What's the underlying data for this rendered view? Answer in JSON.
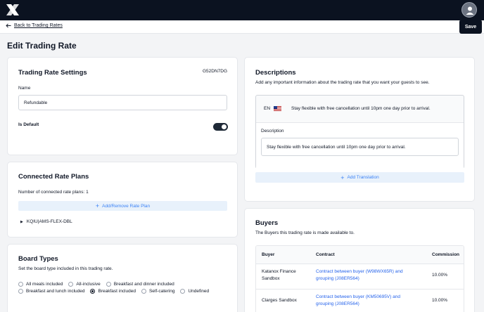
{
  "header": {
    "logo_icon": "x-logo-icon",
    "avatar_icon": "user-icon"
  },
  "nav": {
    "back_label": "Back to Trading Rates",
    "save_label": "Save"
  },
  "page": {
    "title": "Edit Trading Rate"
  },
  "settings": {
    "title": "Trading Rate Settings",
    "code": "G52DN7DG",
    "name_label": "Name",
    "name_value": "Refundable",
    "default_label": "Is Default",
    "default_on": true
  },
  "rate_plans": {
    "title": "Connected Rate Plans",
    "count_text": "Number of connected rate plans: 1",
    "button_label": "Add/Remove Rate Plan",
    "items": [
      "KQIU|AMS-FLEX-DBL"
    ]
  },
  "board_types": {
    "title": "Board Types",
    "subtitle": "Set the board type included in this trading rate.",
    "row1": [
      "All meals included",
      "All-inclusive",
      "Breakfast and dinner included"
    ],
    "row2": [
      "Breakfast and lunch included",
      "Breakfast included",
      "Self-catering",
      "Undefined"
    ],
    "selected": "Breakfast included"
  },
  "descriptions": {
    "title": "Descriptions",
    "subtitle": "Add any important information about the trading rate that you want your guests to see.",
    "lang": "EN",
    "preview": "Stay flexible with free cancellation until 10pm one day prior to arrival.",
    "field_label": "Description",
    "field_value": "Stay flexible with free cancellation until 10pm one day prior to arrival.",
    "add_translation": "Add Translation"
  },
  "buyers": {
    "title": "Buyers",
    "subtitle": "The Buyers this trading rate is made available to.",
    "columns": [
      "Buyer",
      "Contract",
      "Commission"
    ],
    "rows": [
      {
        "buyer_1": "Katanox Finance",
        "buyer_2": "Sandbox",
        "contract_1": "Contract between buyer (W98WX65R) and",
        "contract_2": "grouping (J08ER564)",
        "commission": "10.00%"
      },
      {
        "buyer_1": "Clarges Sandbox",
        "buyer_2": "",
        "contract_1": "Contract between buyer (KM50695V) and",
        "contract_2": "grouping (J08ER564)",
        "commission": "10.00%"
      }
    ]
  },
  "colors": {
    "dark": "#0b1220",
    "accent_blue": "#3b82f6",
    "blue_bg": "#e8f1fb"
  }
}
